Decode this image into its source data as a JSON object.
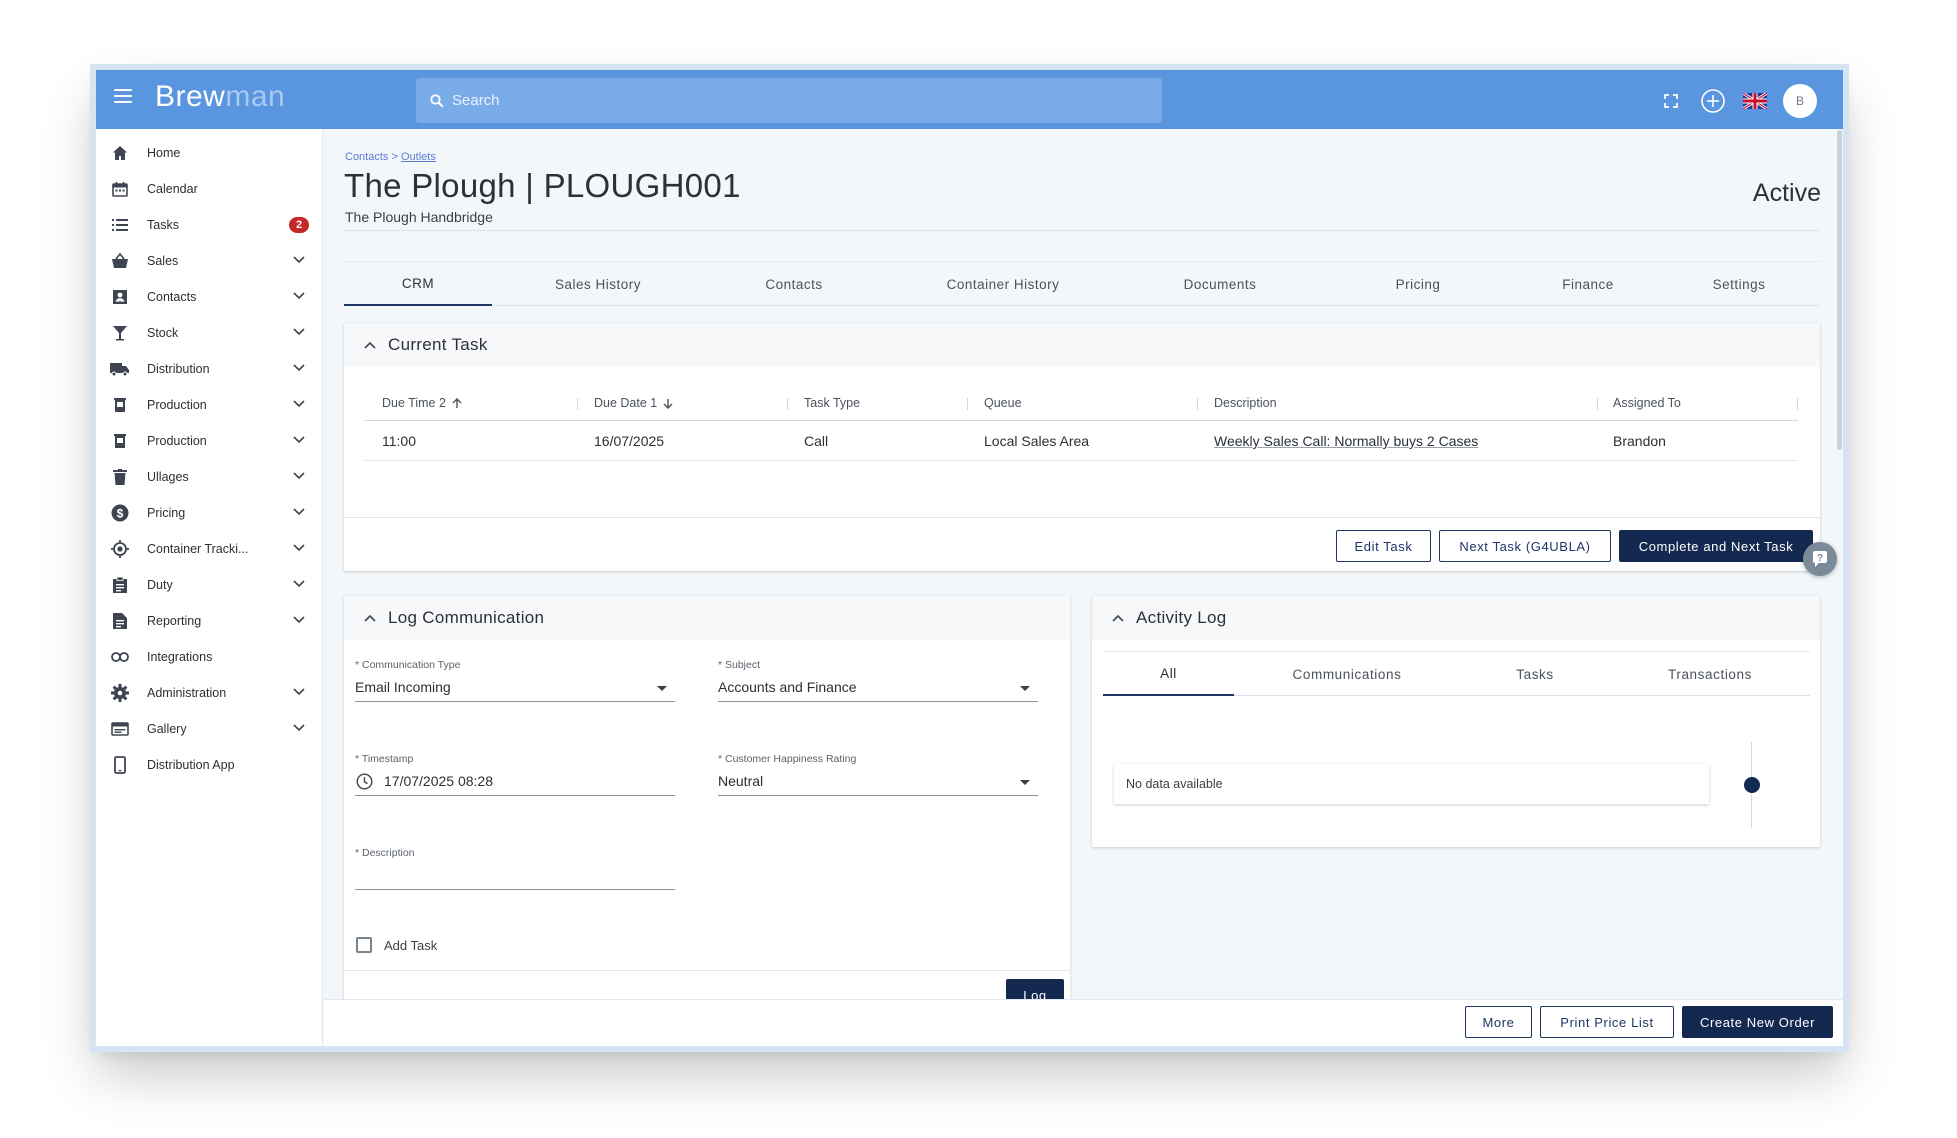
{
  "app": {
    "logo_part1": "Brew",
    "logo_part2": "man",
    "search_placeholder": "Search",
    "avatar_initial": "B",
    "accent_color": "#5a95e0",
    "primary_button_color": "#13294f"
  },
  "sidebar": {
    "items": [
      {
        "label": "Home",
        "icon": "home-icon"
      },
      {
        "label": "Calendar",
        "icon": "calendar-icon"
      },
      {
        "label": "Tasks",
        "icon": "list-icon",
        "badge": "2"
      },
      {
        "label": "Sales",
        "icon": "basket-icon"
      },
      {
        "label": "Contacts",
        "icon": "contacts-icon"
      },
      {
        "label": "Stock",
        "icon": "glass-icon"
      },
      {
        "label": "Distribution",
        "icon": "truck-icon"
      },
      {
        "label": "Production",
        "icon": "vessel-icon"
      },
      {
        "label": "Production",
        "icon": "vessel-icon"
      },
      {
        "label": "Ullages",
        "icon": "bin-icon"
      },
      {
        "label": "Pricing",
        "icon": "dollar-icon"
      },
      {
        "label": "Container Tracki...",
        "icon": "target-icon"
      },
      {
        "label": "Duty",
        "icon": "clipboard-icon"
      },
      {
        "label": "Reporting",
        "icon": "document-icon"
      },
      {
        "label": "Integrations",
        "icon": "link-icon"
      },
      {
        "label": "Administration",
        "icon": "gear-icon"
      },
      {
        "label": "Gallery",
        "icon": "gallery-icon"
      },
      {
        "label": "Distribution App",
        "icon": "phone-icon"
      }
    ]
  },
  "page": {
    "breadcrumb_root": "Contacts",
    "breadcrumb_sep": " > ",
    "breadcrumb_link": "Outlets",
    "title": "The Plough | PLOUGH001",
    "subtitle": "The Plough Handbridge",
    "status": "Active"
  },
  "tabs": [
    "CRM",
    "Sales History",
    "Contacts",
    "Container History",
    "Documents",
    "Pricing",
    "Finance",
    "Settings"
  ],
  "current_task": {
    "heading": "Current Task",
    "columns": [
      "Due Time 2",
      "Due Date 1",
      "Task Type",
      "Queue",
      "Description",
      "Assigned To"
    ],
    "row": {
      "due_time": "11:00",
      "due_date": "16/07/2025",
      "task_type": "Call",
      "queue": "Local Sales Area",
      "description": "Weekly Sales Call: Normally buys 2 Cases",
      "assigned_to": "Brandon"
    },
    "buttons": {
      "edit": "Edit Task",
      "next": "Next Task (G4UBLA)",
      "complete": "Complete and Next Task"
    }
  },
  "log_communication": {
    "heading": "Log Communication",
    "communication_type_label": "* Communication Type",
    "communication_type_value": "Email Incoming",
    "subject_label": "* Subject",
    "subject_value": "Accounts and Finance",
    "timestamp_label": "* Timestamp",
    "timestamp_value": "17/07/2025 08:28",
    "happiness_label": "* Customer Happiness Rating",
    "happiness_value": "Neutral",
    "description_label": "* Description",
    "description_value": "",
    "add_task_label": "Add Task",
    "add_task_checked": false,
    "log_button": "Log"
  },
  "activity_log": {
    "heading": "Activity Log",
    "tabs": [
      "All",
      "Communications",
      "Tasks",
      "Transactions"
    ],
    "empty_text": "No data available"
  },
  "footer": {
    "more": "More",
    "print": "Print Price List",
    "create": "Create New Order"
  }
}
